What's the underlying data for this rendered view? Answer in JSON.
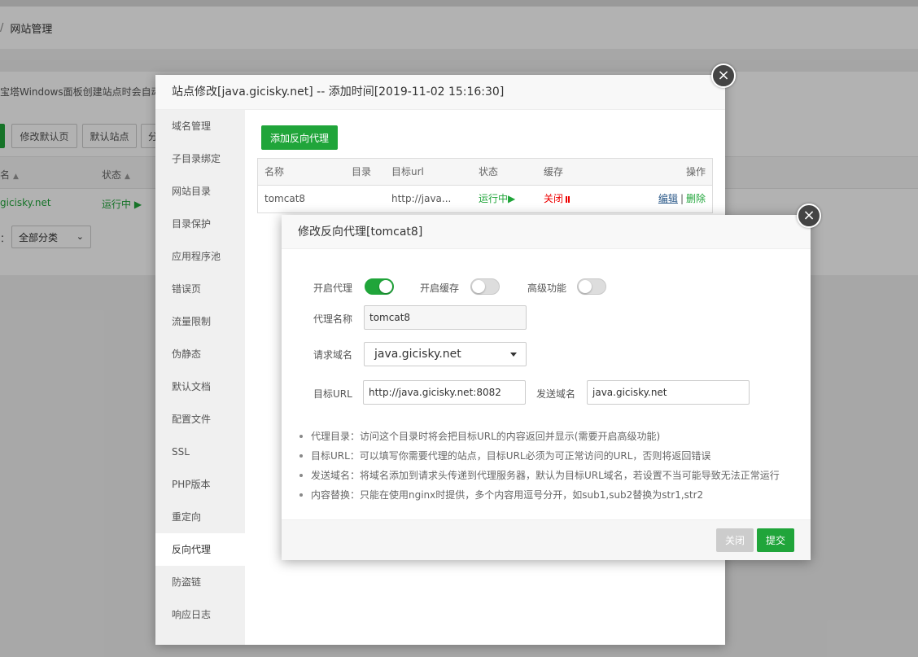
{
  "breadcrumb": {
    "separator": "/",
    "current": "网站管理"
  },
  "bg": {
    "notice": "宝塔Windows面板创建站点时会自动",
    "buttons": [
      "修改默认页",
      "默认站点",
      "分"
    ],
    "columns": [
      "名",
      "状态"
    ],
    "row": {
      "name": "gicisky.net",
      "status": "运行中 ▶"
    },
    "category_label": "：",
    "category_value": "全部分类"
  },
  "site_dialog": {
    "title": "站点修改[java.gicisky.net] -- 添加时间[2019-11-02 15:16:30]",
    "close_icon": "×",
    "menu": [
      "域名管理",
      "子目录绑定",
      "网站目录",
      "目录保护",
      "应用程序池",
      "错误页",
      "流量限制",
      "伪静态",
      "默认文档",
      "配置文件",
      "SSL",
      "PHP版本",
      "重定向",
      "反向代理",
      "防盗链",
      "响应日志"
    ],
    "active_menu": "反向代理",
    "add_button": "添加反向代理",
    "table": {
      "headers": {
        "name": "名称",
        "dir": "目录",
        "url": "目标url",
        "status": "状态",
        "cache": "缓存",
        "ops": "操作"
      },
      "rows": [
        {
          "name": "tomcat8",
          "dir": "",
          "url": "http://java...",
          "status": "运行中▶",
          "cache": "关闭",
          "edit": "编辑",
          "sep": "|",
          "delete": "删除"
        }
      ]
    }
  },
  "proxy_dialog": {
    "title": "修改反向代理[tomcat8]",
    "close_icon": "×",
    "toggles": {
      "proxy": {
        "label": "开启代理",
        "on": true
      },
      "cache": {
        "label": "开启缓存",
        "on": false
      },
      "advanced": {
        "label": "高级功能",
        "on": false
      }
    },
    "proxy_name": {
      "label": "代理名称",
      "value": "tomcat8"
    },
    "request_domain": {
      "label": "请求域名",
      "value": "java.gicisky.net"
    },
    "target_url": {
      "label": "目标URL",
      "value": "http://java.gicisky.net:8082"
    },
    "send_domain": {
      "label": "发送域名",
      "value": "java.gicisky.net"
    },
    "tips": [
      "代理目录：访问这个目录时将会把目标URL的内容返回并显示(需要开启高级功能)",
      "目标URL：可以填写你需要代理的站点，目标URL必须为可正常访问的URL，否则将返回错误",
      "发送域名：将域名添加到请求头传递到代理服务器，默认为目标URL域名，若设置不当可能导致无法正常运行",
      "内容替换：只能在使用nginx时提供，多个内容用逗号分开，如sub1,sub2替换为str1,str2"
    ],
    "buttons": {
      "close": "关闭",
      "submit": "提交"
    }
  },
  "colors": {
    "accent": "#20a53a",
    "danger": "#e00000",
    "link": "#2c5a8a"
  }
}
